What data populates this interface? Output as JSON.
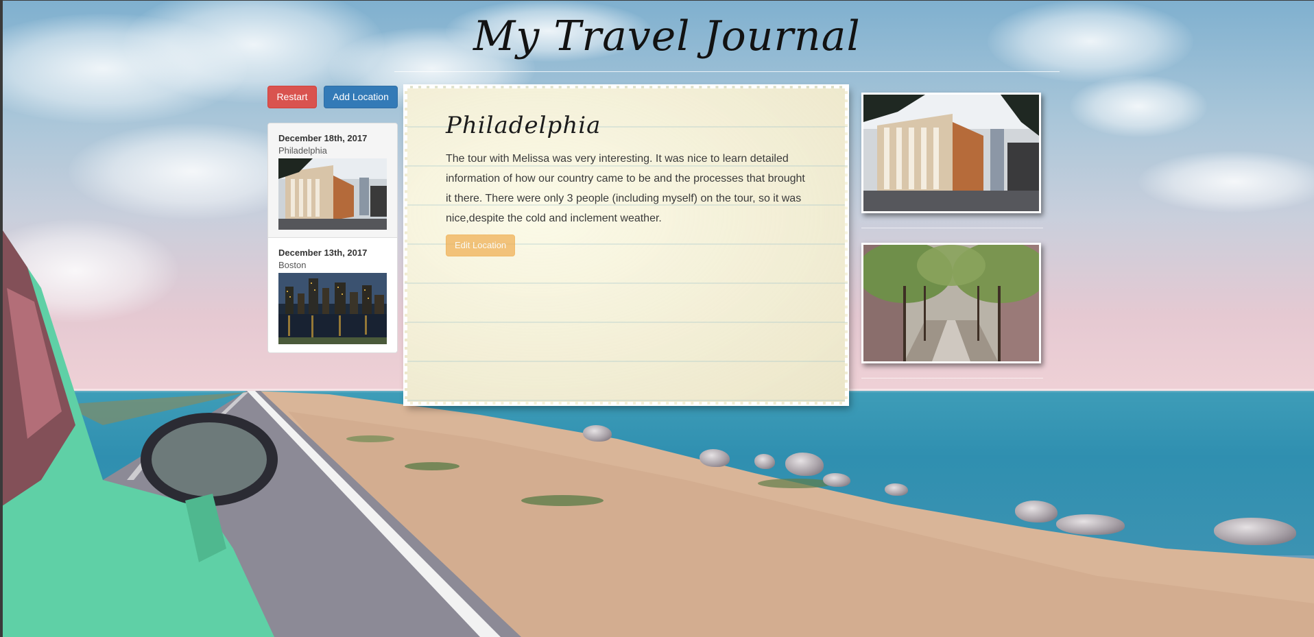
{
  "header": {
    "title": "My Travel Journal"
  },
  "toolbar": {
    "restart_label": "Restart",
    "add_location_label": "Add Location"
  },
  "sidebar": {
    "items": [
      {
        "date": "December 18th, 2017",
        "city": "Philadelphia",
        "image": "philadelphia-street-photo",
        "active": true
      },
      {
        "date": "December 13th, 2017",
        "city": "Boston",
        "image": "boston-skyline-night-photo",
        "active": false
      }
    ]
  },
  "entry": {
    "title": "Philadelphia",
    "body": "The tour with Melissa was very interesting. It was nice to learn detailed information of how our country came to be and the processes that brought it there. There were only 3 people (including myself) on the tour, so it was nice,despite the cold and inclement weather.",
    "edit_label": "Edit Location"
  },
  "photos": [
    {
      "image": "philadelphia-street-photo"
    },
    {
      "image": "tree-lined-street-photo"
    }
  ],
  "colors": {
    "danger": "#d9534f",
    "primary": "#337ab7",
    "warning": "#f0ad4e",
    "paper": "#f4efd4"
  }
}
